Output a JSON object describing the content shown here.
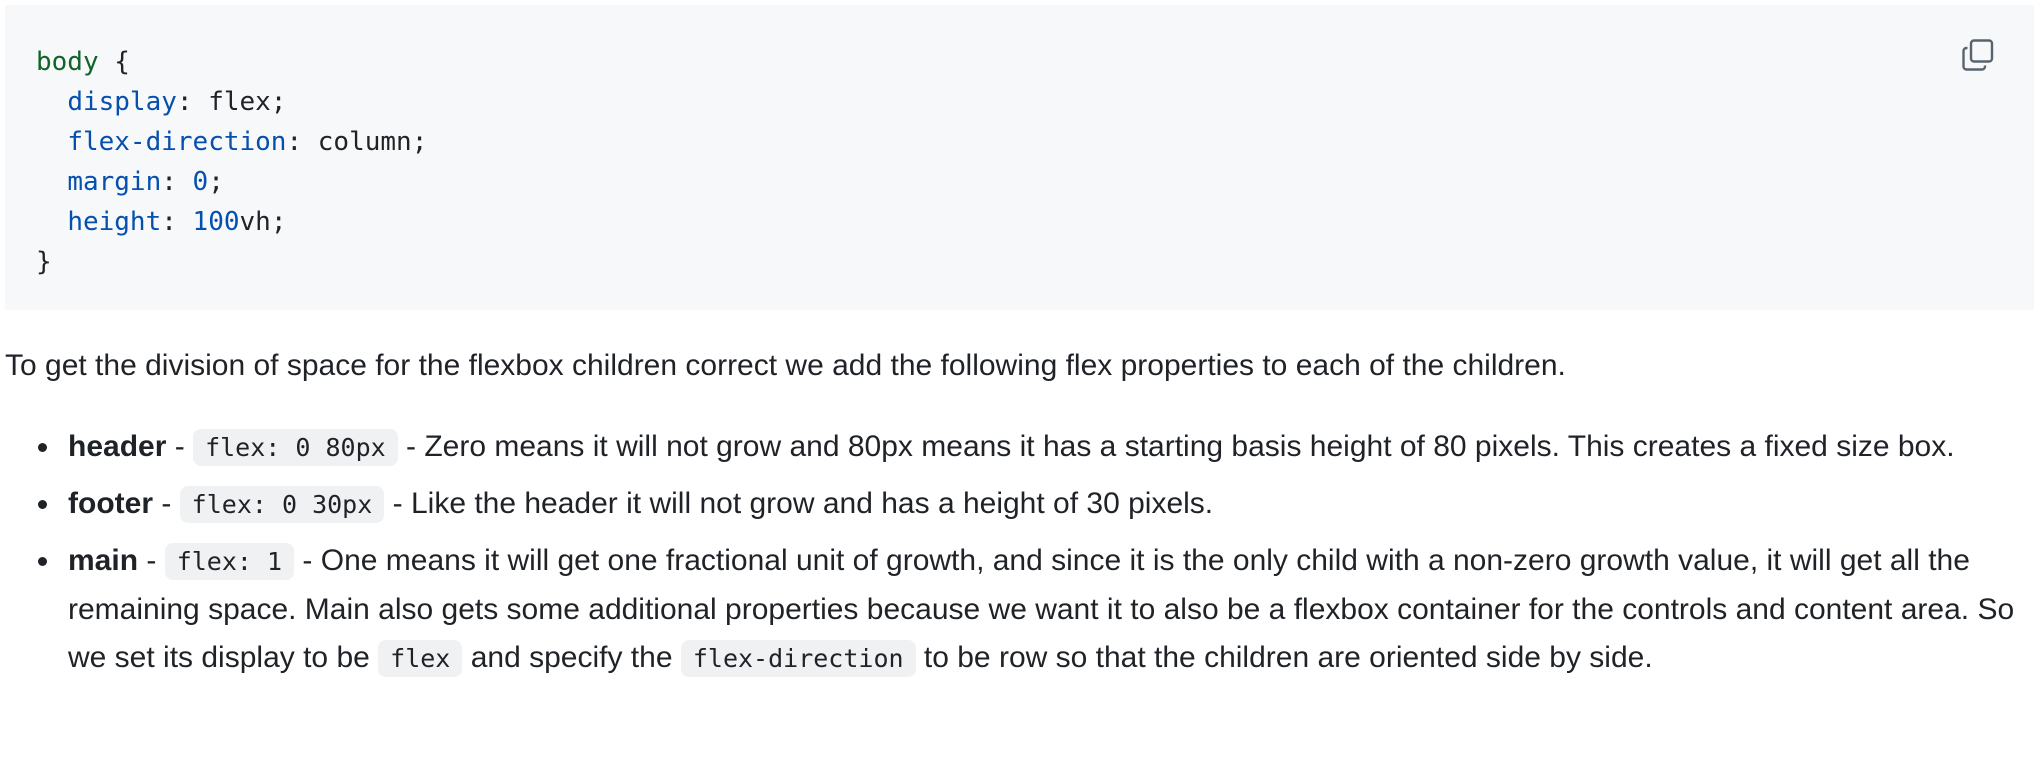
{
  "code_block": {
    "lines": [
      [
        {
          "t": "body",
          "c": "sel"
        },
        {
          "t": " {",
          "c": "plain"
        }
      ],
      [
        {
          "t": "  ",
          "c": "plain"
        },
        {
          "t": "display",
          "c": "prop"
        },
        {
          "t": ": flex;",
          "c": "plain"
        }
      ],
      [
        {
          "t": "  ",
          "c": "plain"
        },
        {
          "t": "flex-direction",
          "c": "prop"
        },
        {
          "t": ": column;",
          "c": "plain"
        }
      ],
      [
        {
          "t": "  ",
          "c": "plain"
        },
        {
          "t": "margin",
          "c": "prop"
        },
        {
          "t": ": ",
          "c": "plain"
        },
        {
          "t": "0",
          "c": "num"
        },
        {
          "t": ";",
          "c": "plain"
        }
      ],
      [
        {
          "t": "  ",
          "c": "plain"
        },
        {
          "t": "height",
          "c": "prop"
        },
        {
          "t": ": ",
          "c": "plain"
        },
        {
          "t": "100",
          "c": "num"
        },
        {
          "t": "vh;",
          "c": "plain"
        }
      ],
      [
        {
          "t": "}",
          "c": "plain"
        }
      ]
    ],
    "copy_icon": "copy-icon"
  },
  "intro": "To get the division of space for the flexbox children correct we add the following flex properties to each of the children.",
  "items": [
    {
      "term": "header",
      "sep1": " - ",
      "code": "flex: 0 80px",
      "sep2": " - ",
      "desc": "Zero means it will not grow and 80px means it has a starting basis height of 80 pixels. This creates a fixed size box."
    },
    {
      "term": "footer",
      "sep1": " - ",
      "code": "flex: 0 30px",
      "sep2": " - ",
      "desc": "Like the header it will not grow and has a height of 30 pixels."
    },
    {
      "term": "main",
      "sep1": " - ",
      "code": "flex: 1",
      "sep2": " - ",
      "desc_a": "One means it will get one fractional unit of growth, and since it is the only child with a non-zero growth value, it will get all the remaining space. Main also gets some additional properties because we want it to also be a flexbox container for the controls and content area. So we set its display to be ",
      "code_b": "flex",
      "desc_b": " and specify the ",
      "code_c": "flex-direction",
      "desc_c": " to be row so that the children are oriented side by side."
    }
  ],
  "colors": {
    "code_bg": "#f6f8fa",
    "selector": "#116329",
    "property": "#0550ae",
    "text": "#1f2328"
  }
}
